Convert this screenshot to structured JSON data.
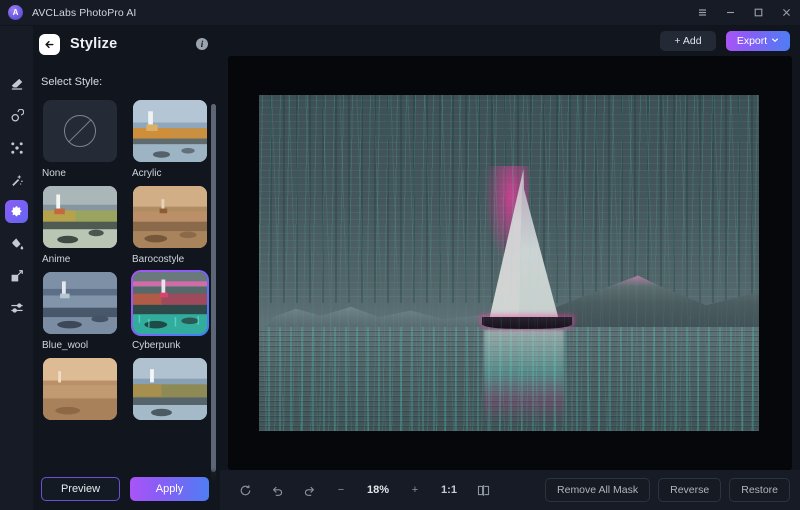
{
  "titlebar": {
    "app_name": "AVCLabs PhotoPro AI",
    "logo_letter": "A",
    "controls": [
      {
        "name": "menu-button",
        "icon": "hamburger-icon"
      },
      {
        "name": "minimize-button",
        "icon": "minimize-icon"
      },
      {
        "name": "maximize-button",
        "icon": "maximize-icon"
      },
      {
        "name": "close-button",
        "icon": "close-icon"
      }
    ]
  },
  "rail": {
    "items": [
      {
        "icon": "eraser-icon",
        "active": false
      },
      {
        "icon": "object-removal-icon",
        "active": false
      },
      {
        "icon": "expand-icon",
        "active": false
      },
      {
        "icon": "magic-wand-icon",
        "active": false
      },
      {
        "icon": "stylize-icon",
        "active": true
      },
      {
        "icon": "paint-bucket-icon",
        "active": false
      },
      {
        "icon": "resize-icon",
        "active": false
      },
      {
        "icon": "adjust-sliders-icon",
        "active": false
      }
    ]
  },
  "panel": {
    "back_label": "←",
    "title": "Stylize",
    "info_label": "i",
    "select_style_label": "Select Style:",
    "styles": [
      {
        "label": "None",
        "selected": false,
        "kind": "none"
      },
      {
        "label": "Acrylic",
        "selected": false,
        "kind": "acrylic"
      },
      {
        "label": "Anime",
        "selected": false,
        "kind": "anime"
      },
      {
        "label": "Barocostyle",
        "selected": false,
        "kind": "baroco"
      },
      {
        "label": "Blue_wool",
        "selected": false,
        "kind": "bluewool"
      },
      {
        "label": "Cyberpunk",
        "selected": true,
        "kind": "cyberpunk"
      },
      {
        "label": "",
        "selected": false,
        "kind": "sepia"
      },
      {
        "label": "",
        "selected": false,
        "kind": "watercolor"
      }
    ],
    "preview_label": "Preview",
    "apply_label": "Apply"
  },
  "top_actions": {
    "add_label": "+ Add",
    "export_label": "Export",
    "export_chevron": "⌄"
  },
  "bottombar": {
    "reset_icon": "reset-icon",
    "undo_icon": "undo-icon",
    "redo_icon": "redo-icon",
    "zoom_out_label": "−",
    "zoom_level": "18%",
    "zoom_in_label": "+",
    "fit_label": "1:1",
    "compare_icon": "compare-icon",
    "remove_all_mask_label": "Remove All Mask",
    "reverse_label": "Reverse",
    "restore_label": "Restore"
  },
  "colors": {
    "accent_purple": "#8b5cf6",
    "accent_blue": "#4f7df3",
    "panel_bg": "#11151d",
    "rail_bg": "#161b25",
    "canvas_bg": "#05070b",
    "text_primary": "#e8ebf0",
    "text_muted": "#aeb6c0"
  }
}
